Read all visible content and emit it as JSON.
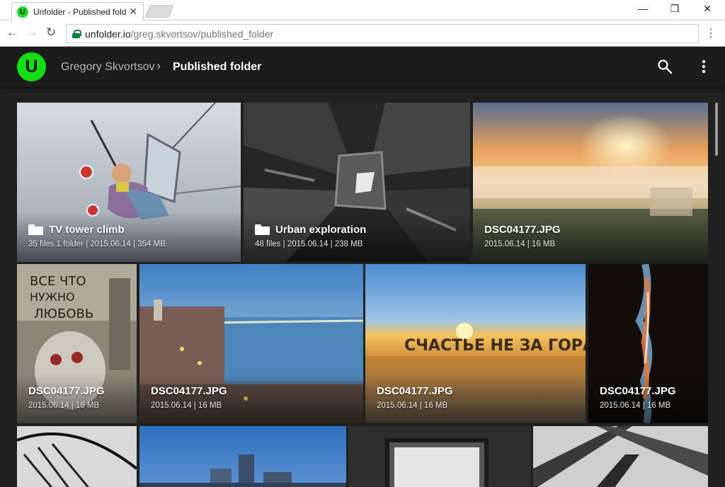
{
  "browser": {
    "tab_title": "Unfolder - Published fold",
    "favicon_letter": "U",
    "url_host": "unfolder.io",
    "url_path": "/greg.skvortsov/published_folder"
  },
  "header": {
    "logo_letter": "U",
    "breadcrumb_user": "Gregory Skvortsov",
    "breadcrumb_current": "Published folder"
  },
  "colors": {
    "brand_green": "#12e012",
    "header_bg": "#1c1c1c",
    "content_bg": "#202020"
  },
  "tiles": [
    {
      "kind": "folder",
      "name": "TV tower climb",
      "meta": "35 files 1 folder  |  2015.06.14  |  354 MB",
      "scene": "sky"
    },
    {
      "kind": "folder",
      "name": "Urban exploration",
      "meta": "48 files  |  2015.06.14  |  238 MB",
      "scene": "bw-stairs"
    },
    {
      "kind": "file",
      "name": "DSC04177.JPG",
      "meta": "2015.06.14  |  16 MB",
      "scene": "sunrise-fog"
    },
    {
      "kind": "file",
      "name": "DSC04177.JPG",
      "meta": "2015.06.14  |  16 MB",
      "scene": "graffiti"
    },
    {
      "kind": "file",
      "name": "DSC04177.JPG",
      "meta": "2015.06.14  |  16 MB",
      "scene": "city-bridge"
    },
    {
      "kind": "file",
      "name": "DSC04177.JPG",
      "meta": "2015.06.14  |  16 MB",
      "scene": "sunset-lake"
    },
    {
      "kind": "file",
      "name": "DSC04177.JPG",
      "meta": "2015.06.14  |  16 MB",
      "scene": "light-streak"
    },
    {
      "kind": "image",
      "scene": "bw-rods"
    },
    {
      "kind": "image",
      "scene": "city-dusk"
    },
    {
      "kind": "image",
      "scene": "bw-window"
    },
    {
      "kind": "image",
      "scene": "bw-beams"
    }
  ]
}
